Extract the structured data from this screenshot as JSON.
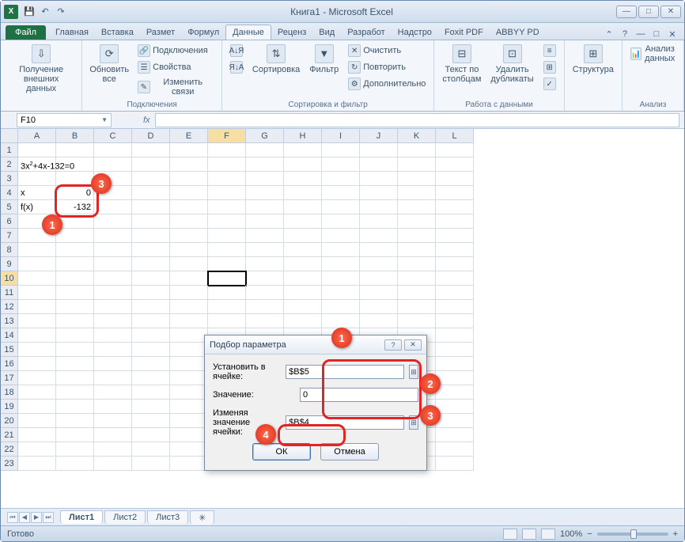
{
  "titlebar": {
    "title": "Книга1 - Microsoft Excel",
    "logo": "X"
  },
  "qat": {
    "save": "💾",
    "undo": "↶",
    "redo": "↷"
  },
  "winbtns": {
    "min": "—",
    "max": "□",
    "close": "✕"
  },
  "tabs": {
    "file": "Файл",
    "items": [
      "Главная",
      "Вставка",
      "Размет",
      "Формул",
      "Данные",
      "Реценз",
      "Вид",
      "Разработ",
      "Надстро",
      "Foxit PDF",
      "ABBYY PD"
    ],
    "active_index": 4
  },
  "ribbon": {
    "g1": {
      "btn": "Получение\nвнешних данных",
      "label": ""
    },
    "g2": {
      "refresh": "Обновить\nвсе",
      "s1": "Подключения",
      "s2": "Свойства",
      "s3": "Изменить связи",
      "label": "Подключения"
    },
    "g3": {
      "sortaz": "А↓Я",
      "sortza": "Я↓А",
      "sort": "Сортировка",
      "filter": "Фильтр",
      "clear": "Очистить",
      "reapply": "Повторить",
      "adv": "Дополнительно",
      "label": "Сортировка и фильтр"
    },
    "g4": {
      "ttc": "Текст по\nстолбцам",
      "dup": "Удалить\nдубликаты",
      "s1": "≡",
      "s2": "⊞",
      "s3": "✓",
      "label": "Работа с данными"
    },
    "g5": {
      "struct": "Структура",
      "label": ""
    },
    "g6": {
      "analysis": "Анализ данных",
      "label": "Анализ"
    }
  },
  "namebox": "F10",
  "fx_label": "fx",
  "columns": [
    "A",
    "B",
    "C",
    "D",
    "E",
    "F",
    "G",
    "H",
    "I",
    "J",
    "K",
    "L"
  ],
  "cells": {
    "a2_pre": "3x",
    "a2_sup": "2",
    "a2_post": "+4x-132=0",
    "a4": "x",
    "b4": "0",
    "a5": "f(x)",
    "b5": "-132"
  },
  "dialog": {
    "title": "Подбор параметра",
    "help": "?",
    "close": "✕",
    "row1_label": "Установить в ячейке:",
    "row1_value": "$B$5",
    "row2_label": "Значение:",
    "row2_value": "0",
    "row3_label": "Изменяя значение ячейки:",
    "row3_value": "$B$4",
    "ok": "ОК",
    "cancel": "Отмена",
    "refpick": "⊞"
  },
  "callouts": {
    "b1": "1",
    "b2": "2",
    "b3": "3",
    "b4": "4"
  },
  "sheets": {
    "s1": "Лист1",
    "s2": "Лист2",
    "s3": "Лист3",
    "nav": [
      "⏮",
      "◀",
      "▶",
      "⏭"
    ],
    "add": "✳"
  },
  "status": {
    "ready": "Готово",
    "zoom": "100%",
    "minus": "−",
    "plus": "+"
  }
}
